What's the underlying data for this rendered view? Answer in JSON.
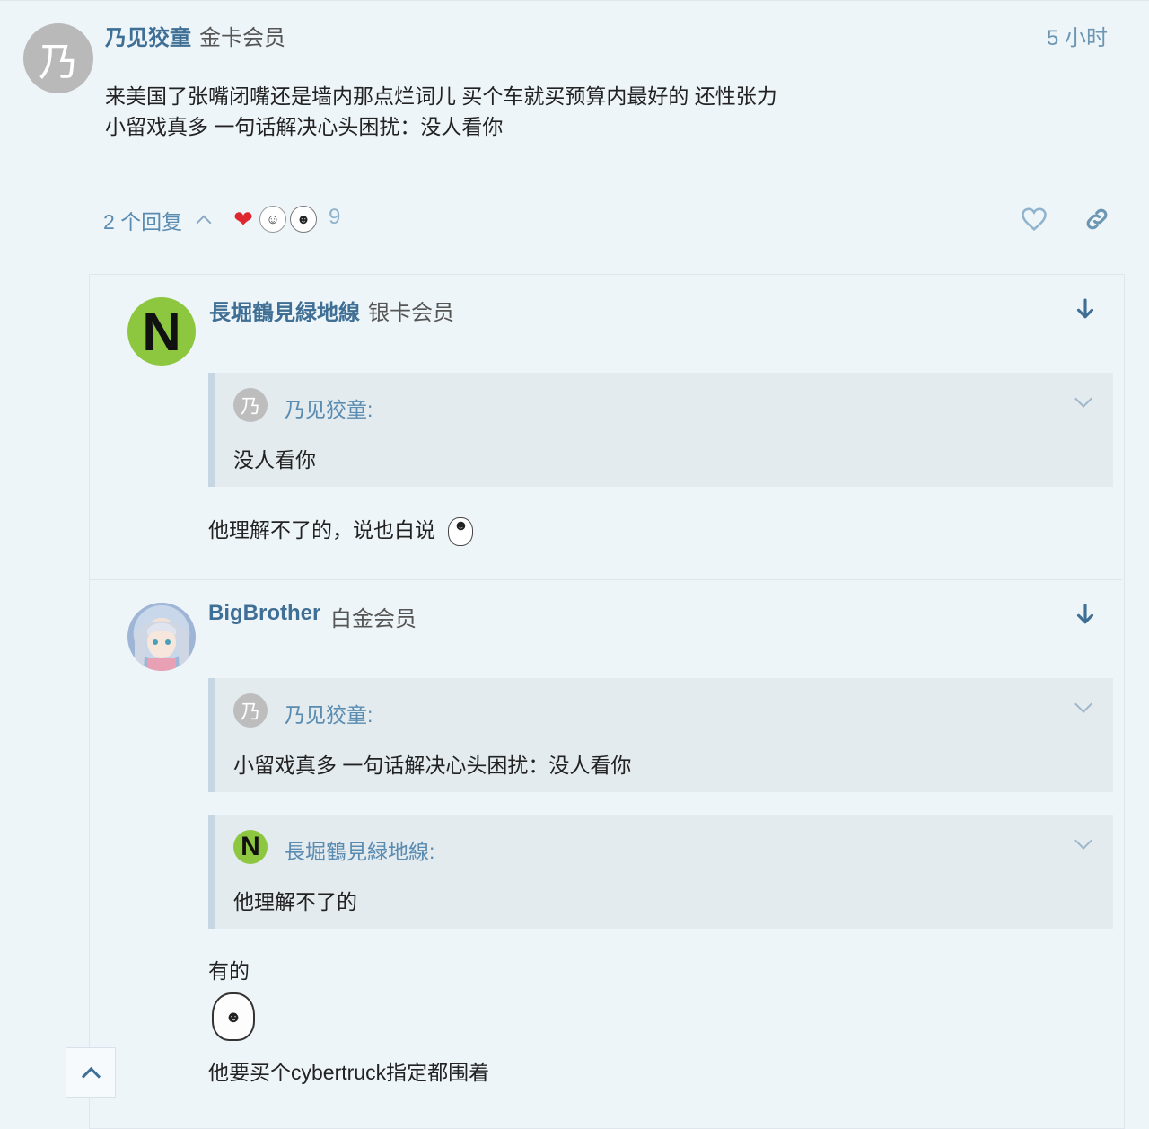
{
  "post": {
    "avatar_letter": "乃",
    "username": "乃见狡童",
    "user_tag": "金卡会员",
    "time": "5 小时",
    "lines": [
      "来美国了张嘴闭嘴还是墙内那点烂词儿 买个车就买预算内最好的 还性张力",
      "小留戏真多 一句话解决心头困扰：没人看你"
    ],
    "reply_count": "2 个回复",
    "reactions": [
      "heart-emoji",
      "trollface-emoji",
      "yaoming-face-emoji"
    ],
    "reaction_count": "9",
    "icons": [
      "like-heart-icon",
      "share-link-icon"
    ]
  },
  "replies": [
    {
      "avatar_letter": "N",
      "username": "長堀鶴見緑地線",
      "user_tag": "银卡会员",
      "quotes": [
        {
          "avatar_letter": "乃",
          "name": "乃见狡童:",
          "text": "没人看你"
        }
      ],
      "text": "他理解不了的，说也白说"
    },
    {
      "username": "BigBrother",
      "user_tag": "白金会员",
      "quotes": [
        {
          "avatar_letter": "乃",
          "name": "乃见狡童:",
          "text": "小留戏真多 一句话解决心头困扰：没人看你"
        },
        {
          "avatar_letter": "N",
          "name": "長堀鶴見緑地線:",
          "text": "他理解不了的"
        }
      ],
      "text1": "有的",
      "text2": "他要买个cybertruck指定都围着"
    }
  ],
  "colors": {
    "background": "#eef5f9",
    "username": "#3f6f95",
    "link": "#5a8bb0",
    "quote_bg": "#e3ebef",
    "quote_border": "#c7d6e3",
    "avatar_green": "#8dc63f"
  }
}
